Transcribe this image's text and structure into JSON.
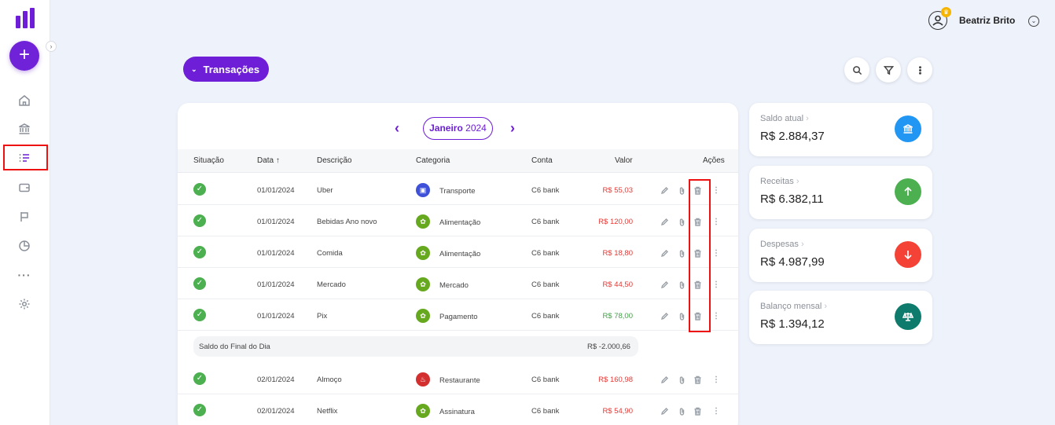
{
  "colors": {
    "brand": "#6d1ed6",
    "negative": "#e53935",
    "positive": "#43a047",
    "success": "#4caf50"
  },
  "header": {
    "user_name": "Beatriz Brito"
  },
  "toolbar": {
    "transactions_label": "Transações"
  },
  "month_nav": {
    "month": "Janeiro",
    "year": "2024"
  },
  "table": {
    "headers": {
      "status": "Situação",
      "date": "Data ↑",
      "description": "Descrição",
      "category": "Categoria",
      "account": "Conta",
      "value": "Valor",
      "actions": "Ações"
    },
    "rows": [
      {
        "date": "01/01/2024",
        "description": "Uber",
        "category": "Transporte",
        "category_icon": "bus-icon",
        "account": "C6 bank",
        "value": "R$ 55,03",
        "type": "neg"
      },
      {
        "date": "01/01/2024",
        "description": "Bebidas Ano novo",
        "category": "Alimentação",
        "category_icon": "food-icon",
        "account": "C6 bank",
        "value": "R$ 120,00",
        "type": "neg"
      },
      {
        "date": "01/01/2024",
        "description": "Comida",
        "category": "Alimentação",
        "category_icon": "food-icon",
        "account": "C6 bank",
        "value": "R$ 18,80",
        "type": "neg"
      },
      {
        "date": "01/01/2024",
        "description": "Mercado",
        "category": "Mercado",
        "category_icon": "food-icon",
        "account": "C6 bank",
        "value": "R$ 44,50",
        "type": "neg"
      },
      {
        "date": "01/01/2024",
        "description": "Pix",
        "category": "Pagamento",
        "category_icon": "food-icon",
        "account": "C6 bank",
        "value": "R$ 78,00",
        "type": "pos"
      },
      {
        "date": "02/01/2024",
        "description": "Almoço",
        "category": "Restaurante",
        "category_icon": "utensils-icon",
        "account": "C6 bank",
        "value": "R$ 160,98",
        "type": "neg"
      },
      {
        "date": "02/01/2024",
        "description": "Netflix",
        "category": "Assinatura",
        "category_icon": "food-icon",
        "account": "C6 bank",
        "value": "R$ 54,90",
        "type": "neg"
      }
    ],
    "day_balance": {
      "label": "Saldo do Final do Dia",
      "value": "R$ -2.000,66"
    }
  },
  "summary": [
    {
      "label": "Saldo atual",
      "amount": "R$ 2.884,37",
      "color": "#2196f3",
      "icon": "bank-icon"
    },
    {
      "label": "Receitas",
      "amount": "R$ 6.382,11",
      "color": "#4caf50",
      "icon": "arrow-up-icon"
    },
    {
      "label": "Despesas",
      "amount": "R$ 4.987,99",
      "color": "#f44336",
      "icon": "arrow-down-icon"
    },
    {
      "label": "Balanço mensal",
      "amount": "R$ 1.394,12",
      "color": "#0f7b6c",
      "icon": "scale-icon"
    }
  ]
}
